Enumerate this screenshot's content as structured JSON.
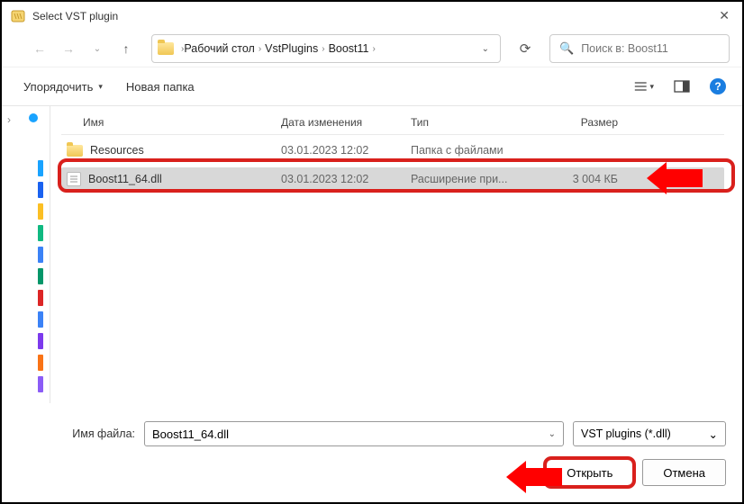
{
  "window": {
    "title": "Select VST plugin"
  },
  "nav": {
    "crumbs": [
      "Рабочий стол",
      "VstPlugins",
      "Boost11"
    ],
    "search_placeholder": "Поиск в: Boost11"
  },
  "toolbar": {
    "organize": "Упорядочить",
    "new_folder": "Новая папка"
  },
  "columns": {
    "name": "Имя",
    "date": "Дата изменения",
    "type": "Тип",
    "size": "Размер"
  },
  "files": [
    {
      "name": "Resources",
      "date": "03.01.2023 12:02",
      "type": "Папка с файлами",
      "size": "",
      "kind": "folder",
      "selected": false
    },
    {
      "name": "Boost11_64.dll",
      "date": "03.01.2023 12:02",
      "type": "Расширение при...",
      "size": "3 004 КБ",
      "kind": "file",
      "selected": true
    }
  ],
  "footer": {
    "filename_label": "Имя файла:",
    "filename_value": "Boost11_64.dll",
    "filter": "VST plugins (*.dll)",
    "open": "Открыть",
    "cancel": "Отмена"
  },
  "side_colors": [
    "#19a3ff",
    "#1a62f0",
    "#fbbf24",
    "#10b981",
    "#3b82f6",
    "#059669",
    "#dc2626",
    "#3b82f6",
    "#7c3aed",
    "#f97316",
    "#8b5cf6"
  ]
}
